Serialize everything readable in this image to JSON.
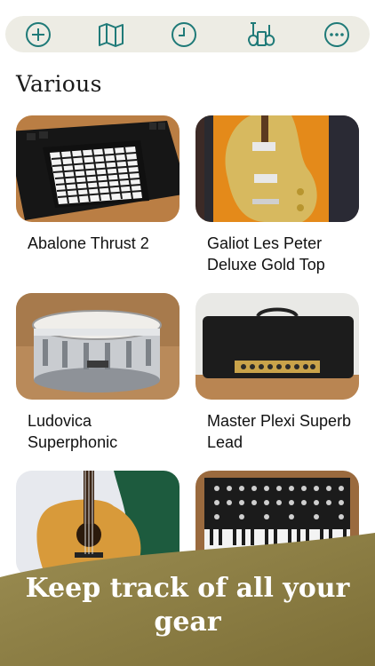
{
  "toolbar": {
    "buttons": [
      {
        "icon": "add-icon"
      },
      {
        "icon": "map-icon"
      },
      {
        "icon": "clock-icon"
      },
      {
        "icon": "guitars-icon"
      },
      {
        "icon": "more-icon"
      }
    ],
    "accent_color": "#1f7a78"
  },
  "section": {
    "title": "Various"
  },
  "items": [
    {
      "name": "Abalone Thrust 2"
    },
    {
      "name": "Galiot Les Peter Deluxe Gold Top"
    },
    {
      "name": "Ludovica Superphonic"
    },
    {
      "name": "Master Plexi Superb Lead"
    },
    {
      "name": ""
    },
    {
      "name": ""
    }
  ],
  "banner": {
    "text": "Keep track of all your gear",
    "color": "#8f8144"
  }
}
